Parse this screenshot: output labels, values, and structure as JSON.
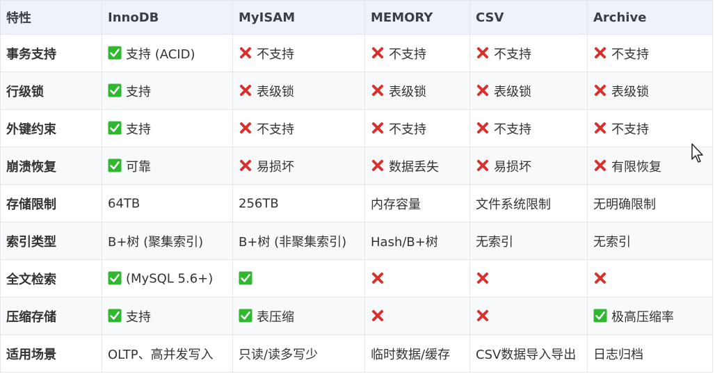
{
  "table": {
    "headers": [
      "特性",
      "InnoDB",
      "MyISAM",
      "MEMORY",
      "CSV",
      "Archive"
    ],
    "rows": [
      {
        "feature": "事务支持",
        "cells": [
          {
            "icon": "check",
            "text": "支持 (ACID)"
          },
          {
            "icon": "cross",
            "text": "不支持"
          },
          {
            "icon": "cross",
            "text": "不支持"
          },
          {
            "icon": "cross",
            "text": "不支持"
          },
          {
            "icon": "cross",
            "text": "不支持"
          }
        ]
      },
      {
        "feature": "行级锁",
        "cells": [
          {
            "icon": "check",
            "text": "支持"
          },
          {
            "icon": "cross",
            "text": "表级锁"
          },
          {
            "icon": "cross",
            "text": "表级锁"
          },
          {
            "icon": "cross",
            "text": "表级锁"
          },
          {
            "icon": "cross",
            "text": "表级锁"
          }
        ]
      },
      {
        "feature": "外键约束",
        "cells": [
          {
            "icon": "check",
            "text": "支持"
          },
          {
            "icon": "cross",
            "text": "不支持"
          },
          {
            "icon": "cross",
            "text": "不支持"
          },
          {
            "icon": "cross",
            "text": "不支持"
          },
          {
            "icon": "cross",
            "text": "不支持"
          }
        ]
      },
      {
        "feature": "崩溃恢复",
        "cells": [
          {
            "icon": "check",
            "text": "可靠"
          },
          {
            "icon": "cross",
            "text": "易损坏"
          },
          {
            "icon": "cross",
            "text": "数据丢失"
          },
          {
            "icon": "cross",
            "text": "易损坏"
          },
          {
            "icon": "cross",
            "text": "有限恢复"
          }
        ]
      },
      {
        "feature": "存储限制",
        "cells": [
          {
            "icon": "",
            "text": "64TB"
          },
          {
            "icon": "",
            "text": "256TB"
          },
          {
            "icon": "",
            "text": "内存容量"
          },
          {
            "icon": "",
            "text": "文件系统限制"
          },
          {
            "icon": "",
            "text": "无明确限制"
          }
        ]
      },
      {
        "feature": "索引类型",
        "cells": [
          {
            "icon": "",
            "text": "B+树 (聚集索引)"
          },
          {
            "icon": "",
            "text": "B+树 (非聚集索引)"
          },
          {
            "icon": "",
            "text": "Hash/B+树"
          },
          {
            "icon": "",
            "text": "无索引"
          },
          {
            "icon": "",
            "text": "无索引"
          }
        ]
      },
      {
        "feature": "全文检索",
        "cells": [
          {
            "icon": "check",
            "text": "(MySQL 5.6+)"
          },
          {
            "icon": "check",
            "text": ""
          },
          {
            "icon": "cross",
            "text": ""
          },
          {
            "icon": "cross",
            "text": ""
          },
          {
            "icon": "cross",
            "text": ""
          }
        ]
      },
      {
        "feature": "压缩存储",
        "cells": [
          {
            "icon": "check",
            "text": "支持"
          },
          {
            "icon": "check",
            "text": "表压缩"
          },
          {
            "icon": "cross",
            "text": ""
          },
          {
            "icon": "cross",
            "text": ""
          },
          {
            "icon": "check",
            "text": "极高压缩率"
          }
        ]
      },
      {
        "feature": "适用场景",
        "cells": [
          {
            "icon": "",
            "text": "OLTP、高并发写入"
          },
          {
            "icon": "",
            "text": "只读/读多写少"
          },
          {
            "icon": "",
            "text": "临时数据/缓存"
          },
          {
            "icon": "",
            "text": "CSV数据导入导出"
          },
          {
            "icon": "",
            "text": "日志归档"
          }
        ]
      }
    ]
  },
  "colors": {
    "check": "#2eb82e",
    "cross": "#d9302c",
    "header_bg": "#eef3fb",
    "border": "#e3e6ea"
  }
}
